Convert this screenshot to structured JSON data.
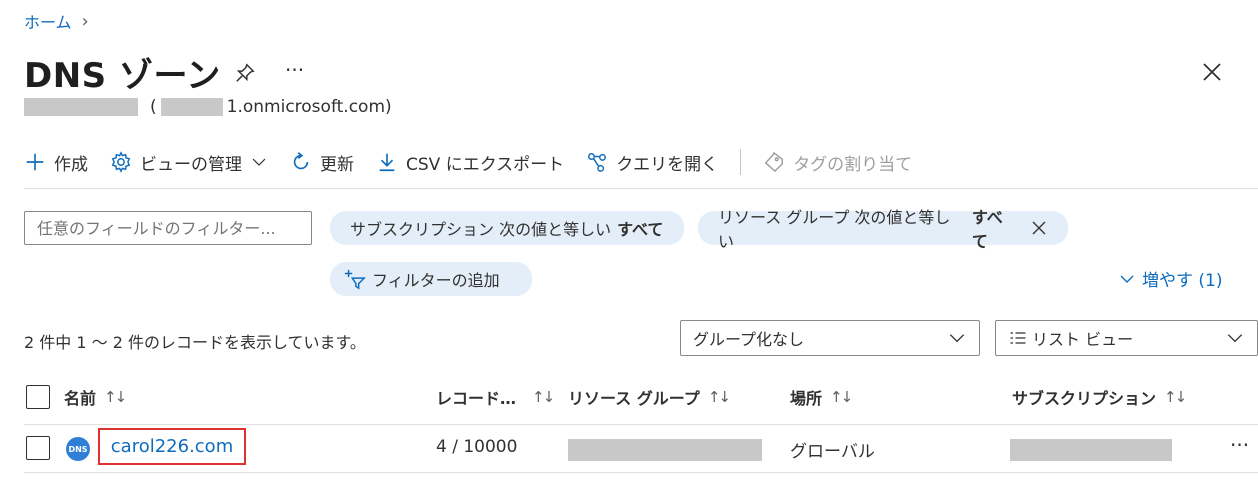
{
  "breadcrumb": {
    "home": "ホーム",
    "chevron": "›"
  },
  "page": {
    "title": "DNS ゾーン",
    "more": "···",
    "subtitle_open": "(",
    "subtitle_domain": "1.onmicrosoft.com)"
  },
  "toolbar": {
    "create": "作成",
    "manage_view": "ビューの管理",
    "refresh": "更新",
    "export_csv": "CSV にエクスポート",
    "open_query": "クエリを開く",
    "assign_tags": "タグの割り当て"
  },
  "filters": {
    "search_placeholder": "任意のフィールドのフィルター...",
    "subscription_prefix": "サブスクリプション 次の値と等しい",
    "subscription_value": "すべて",
    "resource_group_prefix": "リソース グループ 次の値と等しい",
    "resource_group_value": "すべて",
    "add_filter": "フィルターの追加",
    "expand": "増やす (1)"
  },
  "records": {
    "count_text": "2 件中 1 ～ 2 件のレコードを表示しています。",
    "grouping": "グループ化なし",
    "view": "リスト ビュー"
  },
  "table": {
    "columns": {
      "name": "名前",
      "records": "レコード…",
      "resource_group": "リソース グループ",
      "location": "場所",
      "subscription": "サブスクリプション"
    },
    "sort_glyph": "↑↓",
    "rows": [
      {
        "name": "carol226.com",
        "records": "4 / 10000",
        "location": "グローバル",
        "icon_label": "DNS"
      }
    ],
    "row_more": "···"
  },
  "colors": {
    "accent": "#0f6cbd",
    "pill_bg": "#e4eef8",
    "highlight_border": "#e03131"
  }
}
